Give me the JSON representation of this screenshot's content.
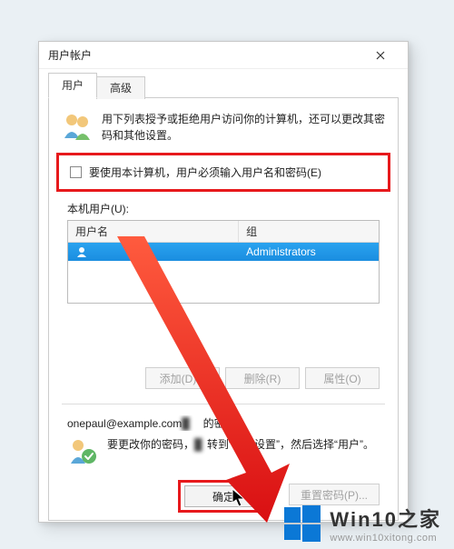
{
  "dialog": {
    "title": "用户帐户"
  },
  "tabs": {
    "users": "用户",
    "advanced": "高级"
  },
  "description": "用下列表授予或拒绝用户访问你的计算机，还可以更改其密码和其他设置。",
  "checkbox": {
    "label": "要使用本计算机，用户必须输入用户名和密码(E)"
  },
  "users_label": "本机用户(U):",
  "listview": {
    "columns": {
      "username": "用户名",
      "group": "组"
    },
    "rows": [
      {
        "username": "",
        "group": "Administrators"
      }
    ]
  },
  "buttons": {
    "add": "添加(D)...",
    "remove": "删除(R)",
    "properties": "属性(O)"
  },
  "password_section": {
    "title_user": "onepaul@example.com",
    "title_suffix": " 的密码",
    "text_prefix": "要更改你的密码，",
    "text_mid": "转到“电脑设置”",
    "text_suffix": "，然后选择“用户”。",
    "reset": "重置密码(P)..."
  },
  "dialog_buttons": {
    "ok": "确定"
  },
  "watermark": {
    "title": "Win10之家",
    "url": "www.win10xitong.com"
  }
}
